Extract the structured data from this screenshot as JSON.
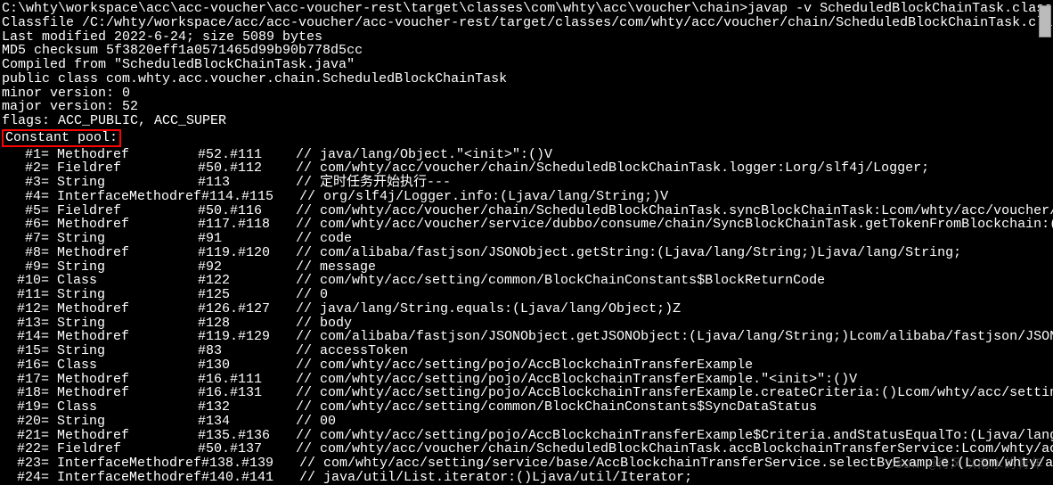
{
  "cmd": "C:\\whty\\workspace\\acc\\acc-voucher\\acc-voucher-rest\\target\\classes\\com\\whty\\acc\\voucher\\chain>javap -v ScheduledBlockChainTask.class",
  "classfile": "Classfile /C:/whty/workspace/acc/acc-voucher/acc-voucher-rest/target/classes/com/whty/acc/voucher/chain/ScheduledBlockChainTask.class",
  "lastmod": "  Last modified 2022-6-24; size 5089 bytes",
  "md5": "  MD5 checksum 5f3820eff1a0571465d99b90b778d5cc",
  "compiled": "  Compiled from \"ScheduledBlockChainTask.java\"",
  "pubclass": "public class com.whty.acc.voucher.chain.ScheduledBlockChainTask",
  "minor": "  minor version: 0",
  "major": "  major version: 52",
  "flags": "  flags: ACC_PUBLIC, ACC_SUPER",
  "constpool": "Constant pool:",
  "pool": [
    {
      "n": "#1",
      "t": "= Methodref",
      "r": "#52.#111",
      "c": "// java/lang/Object.\"<init>\":()V"
    },
    {
      "n": "#2",
      "t": "= Fieldref",
      "r": "#50.#112",
      "c": "// com/whty/acc/voucher/chain/ScheduledBlockChainTask.logger:Lorg/slf4j/Logger;"
    },
    {
      "n": "#3",
      "t": "= String",
      "r": "#113",
      "c": "// 定时任务开始执行---"
    },
    {
      "n": "#4",
      "t": "= InterfaceMethodref",
      "r": "#114.#115",
      "c": "// org/slf4j/Logger.info:(Ljava/lang/String;)V"
    },
    {
      "n": "#5",
      "t": "= Fieldref",
      "r": "#50.#116",
      "c": "// com/whty/acc/voucher/chain/ScheduledBlockChainTask.syncBlockChainTask:Lcom/whty/acc/voucher/service/dub"
    },
    {
      "n": "#6",
      "t": "= Methodref",
      "r": "#117.#118",
      "c": "// com/whty/acc/voucher/service/dubbo/consume/chain/SyncBlockChainTask.getTokenFromBlockchain:()Lcom/aliba"
    },
    {
      "n": "#7",
      "t": "= String",
      "r": "#91",
      "c": "// code"
    },
    {
      "n": "#8",
      "t": "= Methodref",
      "r": "#119.#120",
      "c": "// com/alibaba/fastjson/JSONObject.getString:(Ljava/lang/String;)Ljava/lang/String;"
    },
    {
      "n": "#9",
      "t": "= String",
      "r": "#92",
      "c": "// message"
    },
    {
      "n": "#10",
      "t": "= Class",
      "r": "#122",
      "c": "// com/whty/acc/setting/common/BlockChainConstants$BlockReturnCode"
    },
    {
      "n": "#11",
      "t": "= String",
      "r": "#125",
      "c": "// 0"
    },
    {
      "n": "#12",
      "t": "= Methodref",
      "r": "#126.#127",
      "c": "// java/lang/String.equals:(Ljava/lang/Object;)Z"
    },
    {
      "n": "#13",
      "t": "= String",
      "r": "#128",
      "c": "// body"
    },
    {
      "n": "#14",
      "t": "= Methodref",
      "r": "#119.#129",
      "c": "// com/alibaba/fastjson/JSONObject.getJSONObject:(Ljava/lang/String;)Lcom/alibaba/fastjson/JSONObject;"
    },
    {
      "n": "#15",
      "t": "= String",
      "r": "#83",
      "c": "// accessToken"
    },
    {
      "n": "#16",
      "t": "= Class",
      "r": "#130",
      "c": "// com/whty/acc/setting/pojo/AccBlockchainTransferExample"
    },
    {
      "n": "#17",
      "t": "= Methodref",
      "r": "#16.#111",
      "c": "// com/whty/acc/setting/pojo/AccBlockchainTransferExample.\"<init>\":()V"
    },
    {
      "n": "#18",
      "t": "= Methodref",
      "r": "#16.#131",
      "c": "// com/whty/acc/setting/pojo/AccBlockchainTransferExample.createCriteria:()Lcom/whty/acc/setting/pojo/AccB"
    },
    {
      "n": "#19",
      "t": "= Class",
      "r": "#132",
      "c": "// com/whty/acc/setting/common/BlockChainConstants$SyncDataStatus"
    },
    {
      "n": "#20",
      "t": "= String",
      "r": "#134",
      "c": "// 00"
    },
    {
      "n": "#21",
      "t": "= Methodref",
      "r": "#135.#136",
      "c": "// com/whty/acc/setting/pojo/AccBlockchainTransferExample$Criteria.andStatusEqualTo:(Ljava/lang/String;)Lc"
    },
    {
      "n": "#22",
      "t": "= Fieldref",
      "r": "#50.#137",
      "c": "// com/whty/acc/voucher/chain/ScheduledBlockChainTask.accBlockchainTransferService:Lcom/whty/acc/setting/s"
    },
    {
      "n": "#23",
      "t": "= InterfaceMethodref",
      "r": "#138.#139",
      "c": "// com/whty/acc/setting/service/base/AccBlockchainTransferService.selectByExample:(Lcom/whty/acc/setting/p"
    },
    {
      "n": "#24",
      "t": "= InterfaceMethodref",
      "r": "#140.#141",
      "c": "// java/util/List.iterator:()Ljava/util/Iterator;"
    }
  ],
  "watermark": "CSDN @待风以南水的青年"
}
